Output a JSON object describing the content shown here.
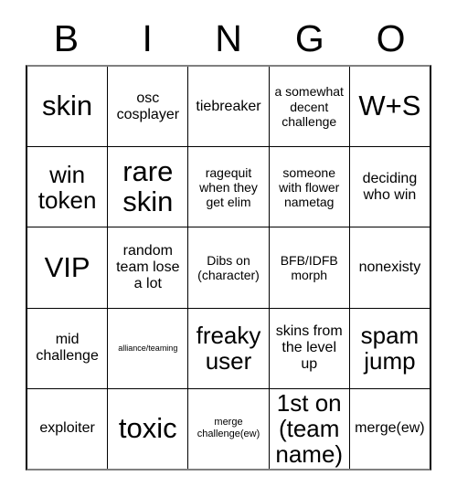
{
  "card": {
    "title": "BINGO",
    "header_letters": [
      "B",
      "I",
      "N",
      "G",
      "O"
    ],
    "colors": {
      "background": "#ffffff",
      "text": "#000000",
      "grid_line": "#000000",
      "outer_edge": "#808080"
    },
    "grid_size": "5x5",
    "rows": [
      [
        {
          "text": "skin",
          "size": "xl"
        },
        {
          "text": "osc cosplayer",
          "size": "md"
        },
        {
          "text": "tiebreaker",
          "size": "md"
        },
        {
          "text": "a somewhat decent challenge",
          "size": "sm"
        },
        {
          "text": "W+S",
          "size": "xl"
        }
      ],
      [
        {
          "text": "win token",
          "size": "lg"
        },
        {
          "text": "rare skin",
          "size": "xl"
        },
        {
          "text": "ragequit when they get elim",
          "size": "sm"
        },
        {
          "text": "someone with flower nametag",
          "size": "sm"
        },
        {
          "text": "deciding who win",
          "size": "md"
        }
      ],
      [
        {
          "text": "VIP",
          "size": "xl"
        },
        {
          "text": "random team lose a lot",
          "size": "md"
        },
        {
          "text": "Dibs on (character)",
          "size": "sm"
        },
        {
          "text": "BFB/IDFB morph",
          "size": "sm"
        },
        {
          "text": "nonexisty",
          "size": "md"
        }
      ],
      [
        {
          "text": "mid challenge",
          "size": "md"
        },
        {
          "text": "alliance/teaming",
          "size": "xxs"
        },
        {
          "text": "freaky user",
          "size": "lg"
        },
        {
          "text": "skins from the level up",
          "size": "md"
        },
        {
          "text": "spam jump",
          "size": "lg"
        }
      ],
      [
        {
          "text": "exploiter",
          "size": "md"
        },
        {
          "text": "toxic",
          "size": "xl"
        },
        {
          "text": "merge challenge(ew)",
          "size": "xs"
        },
        {
          "text": "1st on (team name)",
          "size": "lg"
        },
        {
          "text": "merge(ew)",
          "size": "md"
        }
      ]
    ]
  }
}
